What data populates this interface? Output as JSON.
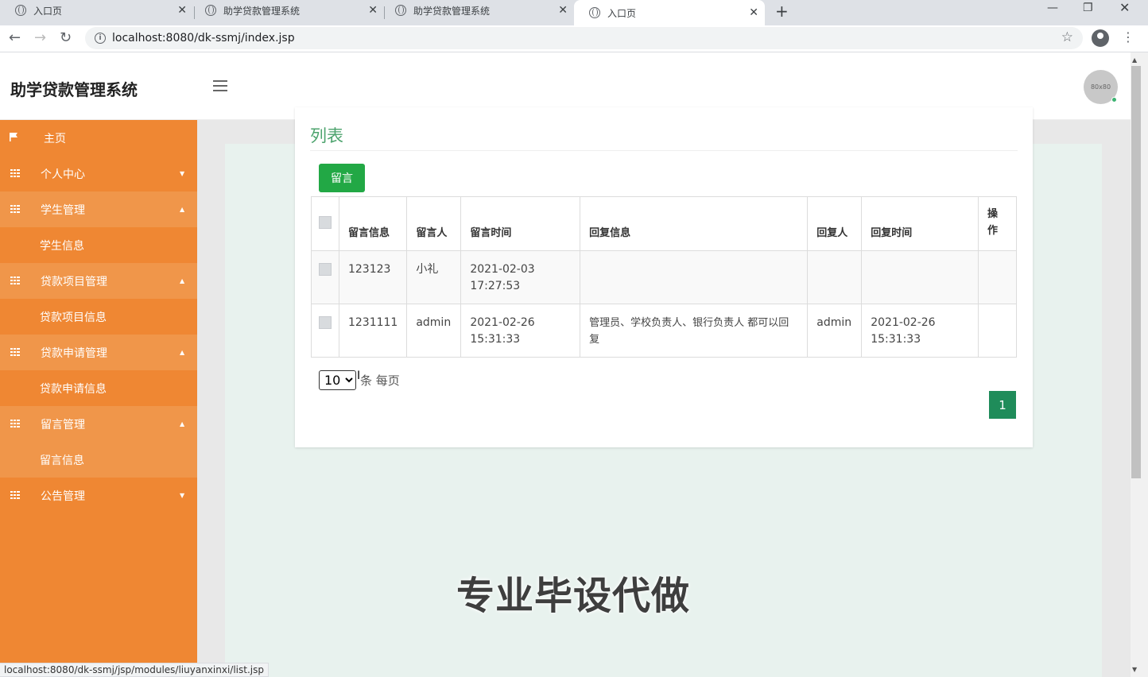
{
  "browser": {
    "tabs": [
      {
        "title": "入口页",
        "active": false
      },
      {
        "title": "助学贷款管理系统",
        "active": false
      },
      {
        "title": "助学贷款管理系统",
        "active": false
      },
      {
        "title": "入口页",
        "active": true
      }
    ],
    "url": "localhost:8080/dk-ssmj/index.jsp",
    "status_url": "localhost:8080/dk-ssmj/jsp/modules/liuyanxinxi/list.jsp"
  },
  "header": {
    "brand": "助学贷款管理系统",
    "avatar_text": "80x80"
  },
  "sidebar": {
    "items": [
      {
        "label": "主页",
        "icon": "flag-icon",
        "caret": ""
      },
      {
        "label": "个人中心",
        "icon": "grid-icon",
        "caret": "▼"
      },
      {
        "label": "学生管理",
        "icon": "grid-icon",
        "caret": "▲"
      },
      {
        "label": "学生信息",
        "icon": "",
        "caret": ""
      },
      {
        "label": "贷款项目管理",
        "icon": "grid-icon",
        "caret": "▲"
      },
      {
        "label": "贷款项目信息",
        "icon": "",
        "caret": ""
      },
      {
        "label": "贷款申请管理",
        "icon": "grid-icon",
        "caret": "▲"
      },
      {
        "label": "贷款申请信息",
        "icon": "",
        "caret": ""
      },
      {
        "label": "留言管理",
        "icon": "grid-icon",
        "caret": "▲"
      },
      {
        "label": "留言信息",
        "icon": "",
        "caret": ""
      },
      {
        "label": "公告管理",
        "icon": "grid-icon",
        "caret": "▼"
      }
    ]
  },
  "panel": {
    "title": "列表",
    "add_button": "留言",
    "columns": [
      "留言信息",
      "留言人",
      "留言时间",
      "回复信息",
      "回复人",
      "回复时间",
      "操作"
    ],
    "rows": [
      {
        "message": "123123",
        "author": "小礼",
        "time": "2021-02-03 17:27:53",
        "reply": "",
        "replier": "",
        "reply_time": ""
      },
      {
        "message": "1231111",
        "author": "admin",
        "time": "2021-02-26 15:31:33",
        "reply": "管理员、学校负责人、银行负责人 都可以回复",
        "replier": "admin",
        "reply_time": "2021-02-26 15:31:33"
      }
    ],
    "page_size": "10",
    "page_size_suffix": "条 每页",
    "current_page": "1"
  },
  "watermark": "专业毕设代做",
  "colors": {
    "sidebar": "#ef8733",
    "accent_green": "#22a845",
    "title_green": "#4ca36d",
    "page_button": "#1f8c5a"
  }
}
